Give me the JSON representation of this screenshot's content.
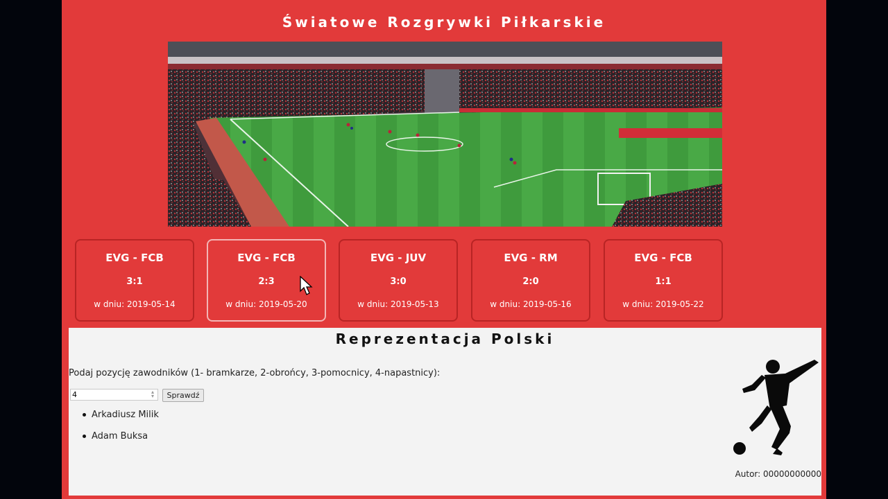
{
  "header": {
    "title": "Światowe Rozgrywki Piłkarskie"
  },
  "hero": {
    "image": "stadium-photo"
  },
  "matches": [
    {
      "teams": "EVG - FCB",
      "score": "3:1",
      "date": "w dniu: 2019-05-14"
    },
    {
      "teams": "EVG - FCB",
      "score": "2:3",
      "date": "w dniu: 2019-05-20"
    },
    {
      "teams": "EVG - JUV",
      "score": "3:0",
      "date": "w dniu: 2019-05-13"
    },
    {
      "teams": "EVG - RM",
      "score": "2:0",
      "date": "w dniu: 2019-05-16"
    },
    {
      "teams": "EVG - FCB",
      "score": "1:1",
      "date": "w dniu: 2019-05-22"
    }
  ],
  "national_team": {
    "title": "Reprezentacja Polski",
    "prompt": "Podaj pozycję zawodników (1- bramkarze, 2-obrońcy, 3-pomocnicy, 4-napastnicy):",
    "input_value": "4",
    "button_label": "Sprawdź",
    "players": [
      "Arkadiusz Milik",
      "Adam Buksa"
    ],
    "author": "Autor: 00000000000"
  },
  "colors": {
    "accent": "#e23a3a",
    "panel": "#f3f3f3"
  },
  "icons": {
    "cursor": "mouse-pointer-icon",
    "player": "football-player-silhouette-icon"
  }
}
